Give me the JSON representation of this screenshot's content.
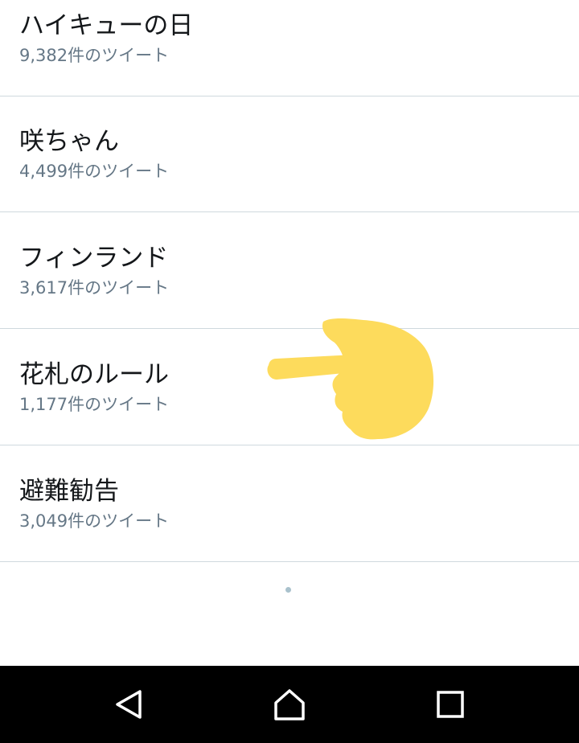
{
  "trends": [
    {
      "title": "ハイキューの日",
      "count": "9,382件のツイート"
    },
    {
      "title": "咲ちゃん",
      "count": "4,499件のツイート"
    },
    {
      "title": "フィンランド",
      "count": "3,617件のツイート"
    },
    {
      "title": "花札のルール",
      "count": "1,177件のツイート"
    },
    {
      "title": "避難勧告",
      "count": "3,049件のツイート"
    }
  ],
  "annotation": {
    "icon": "pointing-hand-icon",
    "color": "#fddb5c"
  },
  "navbar": {
    "back_icon": "back-triangle-icon",
    "home_icon": "home-icon",
    "recents_icon": "recents-square-icon"
  },
  "colors": {
    "title": "#14171a",
    "count": "#657786",
    "divider": "#cfd9de",
    "navbar": "#000000"
  }
}
